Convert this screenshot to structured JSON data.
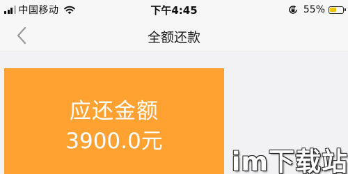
{
  "status_bar": {
    "carrier": "中国移动",
    "time": "下午4:45",
    "battery_percent": "55%",
    "battery_level": 0.55,
    "icons": [
      "signal-icon",
      "wifi-icon",
      "lock-rotation-icon",
      "battery-icon"
    ]
  },
  "nav": {
    "back_icon": "chevron-left-icon",
    "title": "全额还款"
  },
  "card": {
    "label": "应还金额",
    "amount": "3900.0元",
    "color": "#ffa232"
  },
  "watermark": {
    "text": "im下载站"
  },
  "colors": {
    "accent": "#ffa232",
    "background": "#f2f2f4",
    "bar": "#f7f7f7"
  }
}
